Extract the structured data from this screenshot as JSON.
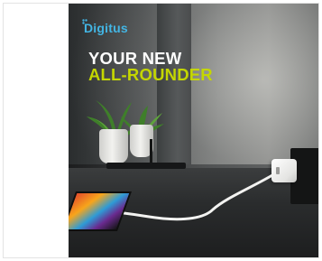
{
  "brand": {
    "logo_text": "Digitus",
    "logo_color": "#43b5e3"
  },
  "headline": {
    "line1": "YOUR NEW",
    "line2": "ALL-ROUNDER",
    "line1_color": "#ffffff",
    "line2_color": "#c4d600"
  },
  "banner": {
    "scene": [
      "plant-pots",
      "desk",
      "wall-outlet",
      "usb-charger",
      "cable",
      "tablet"
    ]
  }
}
